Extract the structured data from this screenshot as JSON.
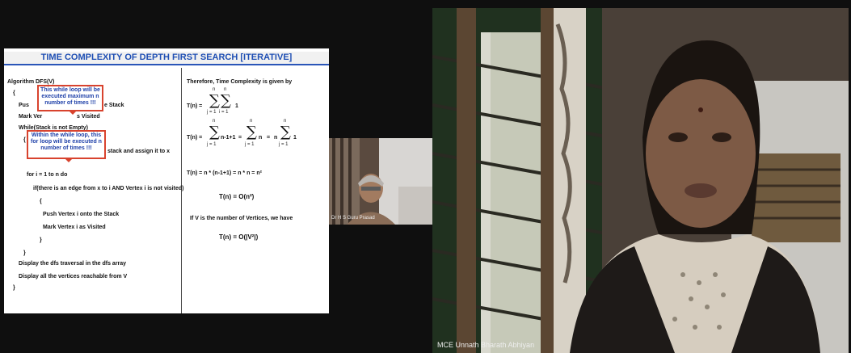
{
  "slide": {
    "title": "TIME COMPLEXITY OF DEPTH FIRST SEARCH [ITERATIVE]",
    "left_lines": [
      "Algorithm DFS(V)",
      "{",
      "Pus",
      "e Stack",
      "Mark Ver",
      "s Visited",
      "While(Stack is not Empty)",
      "{",
      "stack and assign it to x",
      "for i = 1 to n do",
      "if(there is an edge from x to i AND Vertex i is not visited)",
      "{",
      "Push Vertex i onto the Stack",
      "Mark Vertex i as Visited",
      "}",
      "}",
      "Display the dfs traversal in the dfs array",
      "Display all the vertices reachable from V",
      "}"
    ],
    "callout_1": [
      "This while loop will be",
      "executed maximum n",
      "number of times !!!"
    ],
    "callout_2": [
      "Within the while loop, this",
      "for loop will be executed n",
      "number of times !!!"
    ],
    "right": {
      "heading": "Therefore, Time Complexity is given by",
      "eq1_lhs": "T(n) =",
      "eq1_term": "1",
      "eq2_lhs": "T(n) =",
      "eq2_term1": "n-1+1",
      "eq2_eq": "=",
      "eq2_term2": "n",
      "eq2_eq2": "=",
      "eq2_n": "n",
      "eq2_term3": "1",
      "lim_top": "n",
      "lim_j": "j = 1",
      "lim_i": "i = 1",
      "eq3": "T(n) =  n * (n-1+1)  =   n * n   =   n²",
      "eq4": "T(n) = O(n²)",
      "note": "If V is the number of Vertices, we have",
      "eq5": "T(n) = O(|V²|)"
    }
  },
  "participants": {
    "small_name": "Dr H S Guru Prasad",
    "large_name": "MCE Unnath Bharath Abhiyan"
  }
}
